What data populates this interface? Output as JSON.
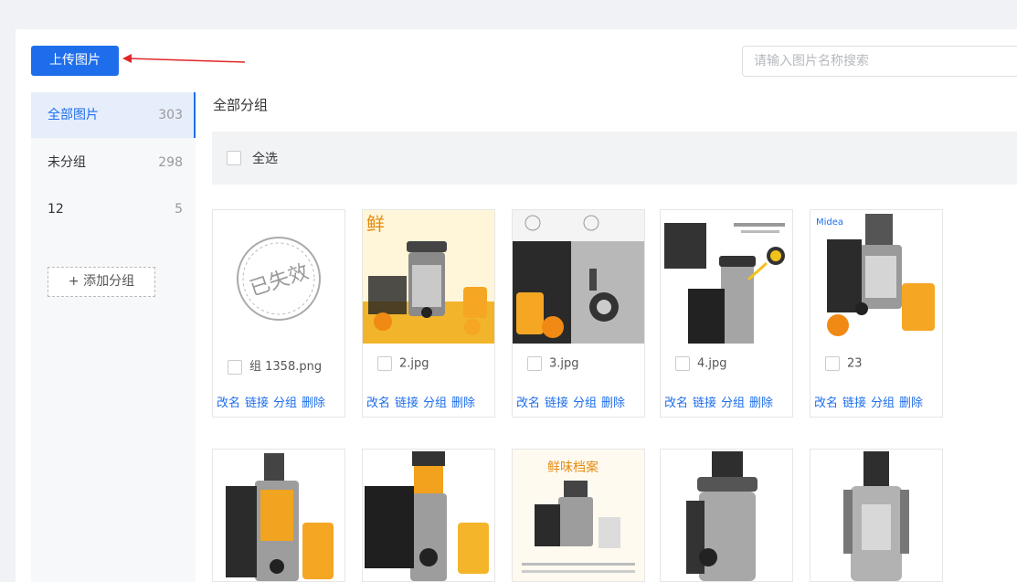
{
  "toolbar": {
    "upload_label": "上传图片"
  },
  "search": {
    "placeholder": "请输入图片名称搜索"
  },
  "sidebar": {
    "groups": [
      {
        "label": "全部图片",
        "count": "303"
      },
      {
        "label": "未分组",
        "count": "298"
      },
      {
        "label": "12",
        "count": "5"
      }
    ],
    "add_label": "+ 添加分组"
  },
  "main": {
    "breadcrumb": "全部分组",
    "select_all": "全选",
    "actions": [
      "改名",
      "链接",
      "分组",
      "删除"
    ],
    "images": [
      {
        "name": "组 1358.png",
        "stamp": "已失效"
      },
      {
        "name": "2.jpg",
        "overlay_text": "鲜"
      },
      {
        "name": "3.jpg"
      },
      {
        "name": "4.jpg"
      },
      {
        "name": "23",
        "brand": "Midea"
      }
    ],
    "row2_overlay": "鲜味档案"
  },
  "colors": {
    "accent": "#1e6eec",
    "arrow": "#e0262a"
  }
}
